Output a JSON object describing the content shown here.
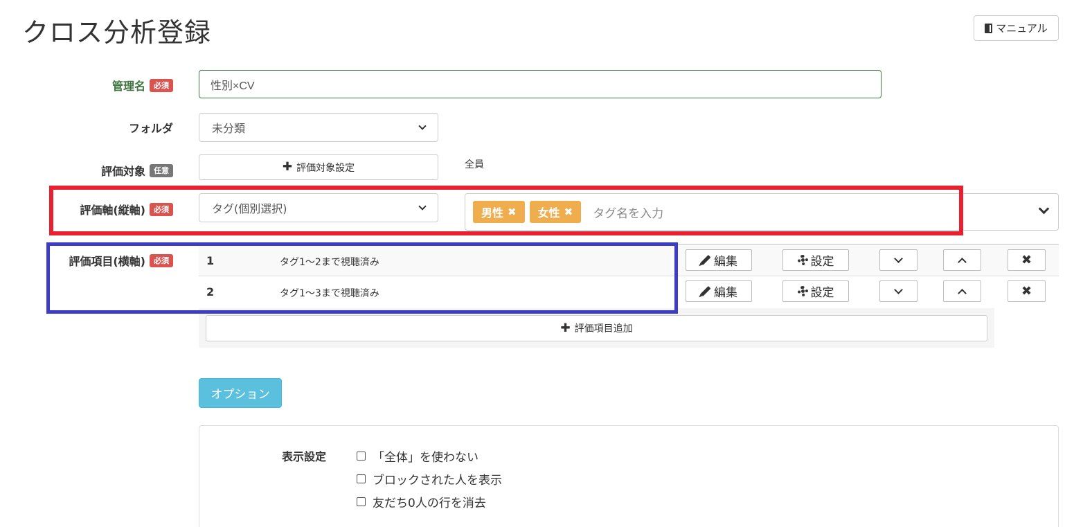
{
  "page": {
    "title": "クロス分析登録",
    "manual_label": "マニュアル"
  },
  "form": {
    "name": {
      "label": "管理名",
      "badge": "必須",
      "value": "性別×CV"
    },
    "folder": {
      "label": "フォルダ",
      "selected": "未分類"
    },
    "target": {
      "label": "評価対象",
      "badge": "任意",
      "button_label": "評価対象設定",
      "value": "全員"
    },
    "vertical_axis": {
      "label": "評価軸(縦軸)",
      "badge": "必須",
      "selected": "タグ(個別選択)",
      "tags": [
        "男性",
        "女性"
      ],
      "tag_remove_glyph": "✖",
      "tag_placeholder": "タグ名を入力"
    },
    "horizontal_axis": {
      "label": "評価項目(横軸)",
      "badge": "必須",
      "items": [
        {
          "num": "1",
          "name": "タグ1～2まで視聴済み"
        },
        {
          "num": "2",
          "name": "タグ1～3まで視聴済み"
        }
      ],
      "edit_label": "編集",
      "settings_label": "設定",
      "delete_glyph": "✖",
      "add_label": "評価項目追加"
    }
  },
  "options": {
    "button_label": "オプション",
    "display_label": "表示設定",
    "checkboxes": [
      {
        "label": "「全体」を使わない",
        "checked": false
      },
      {
        "label": "ブロックされた人を表示",
        "checked": false
      },
      {
        "label": "友だち0人の行を消去",
        "checked": false
      }
    ]
  },
  "colors": {
    "required_badge": "#d9534f",
    "optional_badge": "#777777",
    "tag_chip": "#f0ad4e",
    "option_button": "#5bc0de",
    "red_highlight": "#e8202f",
    "blue_highlight": "#3c3cc8"
  }
}
